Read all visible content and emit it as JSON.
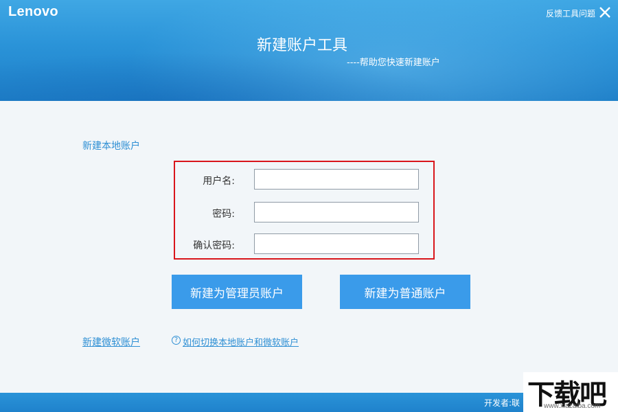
{
  "header": {
    "logo": "Lenovo",
    "feedback_label": "反馈工具问题",
    "close_icon": "close-icon",
    "title": "新建账户工具",
    "subtitle": "----帮助您快速新建账户"
  },
  "form": {
    "section_title": "新建本地账户",
    "username_label": "用户名:",
    "username_value": "",
    "password_label": "密码:",
    "password_value": "",
    "confirm_label": "确认密码:",
    "confirm_value": "",
    "highlight_color": "#d9151b"
  },
  "buttons": {
    "admin_label": "新建为管理员账户",
    "standard_label": "新建为普通账户"
  },
  "links": {
    "microsoft_account": "新建微软账户",
    "help_icon": "help-circle-icon",
    "how_to_switch": "如何切换本地账户和微软账户"
  },
  "footer": {
    "developer_label": "开发者:联"
  },
  "watermark": {
    "text": "下载吧",
    "url": "www.xiazaiba.com"
  },
  "colors": {
    "accent": "#3a9bea",
    "header_blue": "#2a93d8",
    "link_blue": "#2e8fd4"
  }
}
